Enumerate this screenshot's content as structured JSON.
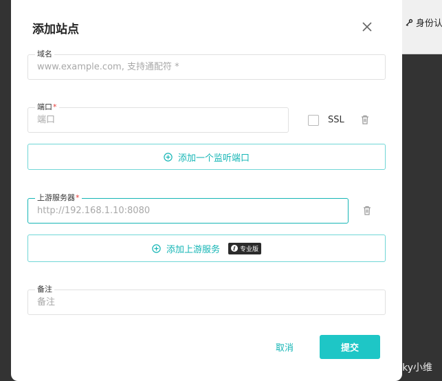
{
  "background_page": {
    "auth_label": "身份认"
  },
  "modal": {
    "title": "添加站点",
    "close_icon": "close-icon"
  },
  "domain_field": {
    "label": "域名",
    "placeholder": "www.example.com, 支持通配符 *",
    "value": ""
  },
  "port_field": {
    "label": "端口",
    "required": "*",
    "placeholder": "端口",
    "value": "",
    "ssl_label": "SSL",
    "ssl_checked": false
  },
  "add_port_button": {
    "label": "添加一个监听端口",
    "icon": "plus-circle-icon"
  },
  "upstream_field": {
    "label": "上游服务器",
    "required": "*",
    "placeholder": "http://192.168.1.10:8080",
    "value": ""
  },
  "add_upstream_button": {
    "label": "添加上游服务",
    "icon": "plus-circle-icon",
    "badge": "专业版"
  },
  "remark_field": {
    "label": "备注",
    "placeholder": "备注",
    "value": ""
  },
  "footer": {
    "cancel_label": "取消",
    "submit_label": "提交"
  },
  "watermark": "CSDN @Lucky小维",
  "colors": {
    "accent": "#1ec6c6",
    "accent_text": "#14b5b5",
    "required": "#e53935",
    "overlay": "#333333"
  }
}
